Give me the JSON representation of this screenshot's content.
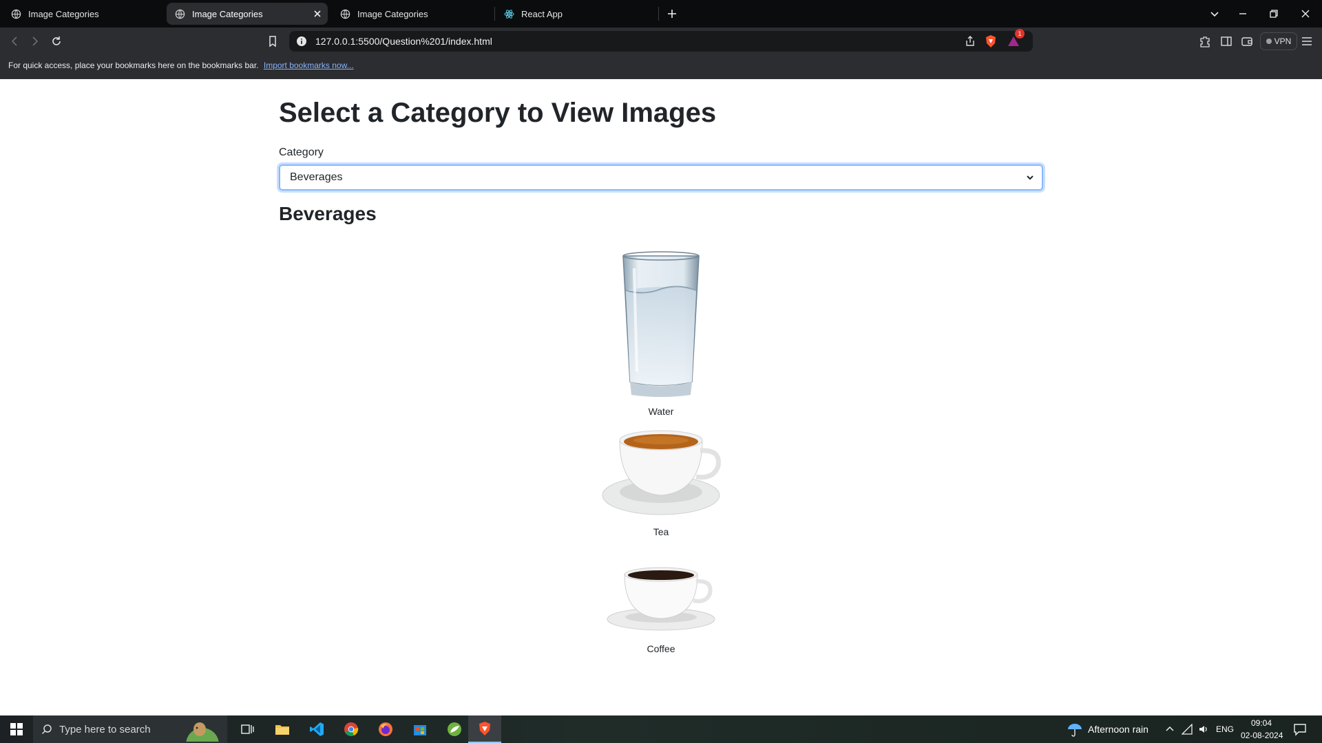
{
  "browser": {
    "tabs": [
      {
        "title": "Image Categories"
      },
      {
        "title": "Image Categories"
      },
      {
        "title": "Image Categories"
      },
      {
        "title": "React App"
      }
    ],
    "url": "127.0.0.1:5500/Question%201/index.html",
    "vpn_label": "VPN",
    "bookmarks_prompt": "For quick access, place your bookmarks here on the bookmarks bar.",
    "bookmarks_link": "Import bookmarks now...",
    "notification_count": "1"
  },
  "page": {
    "heading": "Select a Category to View Images",
    "select_label": "Category",
    "select_value": "Beverages",
    "section_title": "Beverages",
    "items": [
      {
        "caption": "Water",
        "icon": "water-glass-image"
      },
      {
        "caption": "Tea",
        "icon": "tea-cup-image"
      },
      {
        "caption": "Coffee",
        "icon": "coffee-cup-image"
      }
    ]
  },
  "taskbar": {
    "search_placeholder": "Type here to search",
    "weather": "Afternoon rain",
    "language": "ENG",
    "time": "09:04",
    "date": "02-08-2024"
  }
}
